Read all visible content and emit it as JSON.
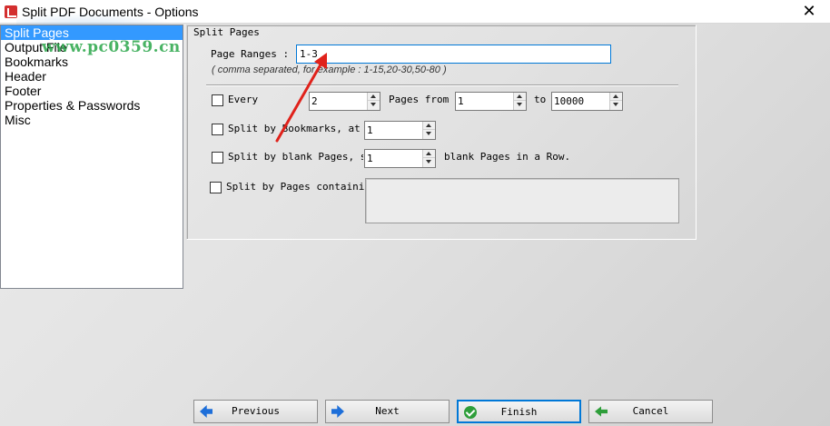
{
  "window": {
    "title": "Split PDF Documents - Options",
    "close_glyph": "✕"
  },
  "watermark": {
    "text": "www.pc0359.cn"
  },
  "nav": {
    "items": [
      {
        "label": "Split Pages",
        "selected": true
      },
      {
        "label": "Output File"
      },
      {
        "label": "Bookmarks"
      },
      {
        "label": "Header"
      },
      {
        "label": "Footer"
      },
      {
        "label": "Properties & Passwords"
      },
      {
        "label": "Misc"
      }
    ]
  },
  "split_pages": {
    "group_label": "Split Pages",
    "page_ranges": {
      "label": "Page Ranges :",
      "value": "1-3",
      "hint": "( comma separated, for example : 1-15,20-30,50-80 )"
    },
    "every": {
      "label": "Every",
      "checked": false,
      "value": "2",
      "pages_from_label": "Pages from",
      "from_value": "1",
      "to_label": "to",
      "to_value": "10000"
    },
    "by_bookmarks": {
      "label": "Split by Bookmarks, at le",
      "checked": false,
      "value": "1"
    },
    "by_blank_pages": {
      "label": "Split by blank Pages, spl",
      "checked": false,
      "value": "1",
      "suffix": "blank Pages in a Row."
    },
    "by_pages_containing": {
      "label": "Split by Pages containing",
      "checked": false,
      "value": ""
    }
  },
  "buttons": {
    "previous": "Previous",
    "next": "Next",
    "finish": "Finish",
    "cancel": "Cancel"
  },
  "annotation": {
    "color": "#e0221b"
  }
}
